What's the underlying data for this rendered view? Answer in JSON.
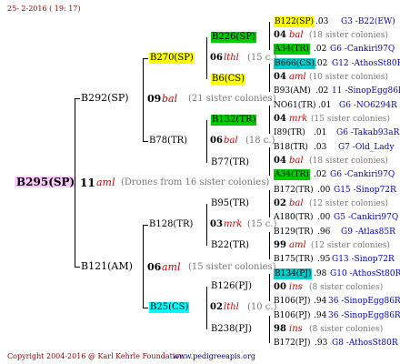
{
  "header": {
    "date": "25- 2-2016 ( 19: 17)"
  },
  "root": {
    "id": "B295(SP)",
    "num": "11",
    "race": "aml",
    "note": "(Drones from 16 sister colonies)"
  },
  "gen1": {
    "upper": {
      "id": "B292(SP)",
      "num": "09",
      "race": "bal",
      "note": "(21 sister colonies)"
    },
    "lower": {
      "id": "B121(AM)",
      "num": "06",
      "race": "aml",
      "note": "(15 sister colonies)"
    }
  },
  "gen2": [
    {
      "id": "B270(SP)",
      "num": "06",
      "race": "lthl",
      "note": "(15 c.)",
      "bg": "#ffff00"
    },
    {
      "id": "B78(TR)",
      "num": "06",
      "race": "bal",
      "note": "(18 c.)",
      "bg": ""
    },
    {
      "id": "B128(TR)",
      "num": "03",
      "race": "mrk",
      "note": "(15 c.)",
      "bg": ""
    },
    {
      "id": "B25(CS)",
      "num": "02",
      "race": "lthl",
      "note": "(10 c.)",
      "bg": "#00ffff"
    }
  ],
  "gen3": [
    {
      "id": "B226(SP)",
      "bg": "#00cc00"
    },
    {
      "id": "B6(CS)",
      "bg": "#ffff00"
    },
    {
      "id": "B132(TR)",
      "bg": "#00cc00"
    },
    {
      "id": "B77(TR)",
      "bg": ""
    },
    {
      "id": "B95(TR)",
      "bg": ""
    },
    {
      "id": "B22(TR)",
      "bg": ""
    },
    {
      "id": "B126(PJ)",
      "bg": ""
    },
    {
      "id": "B238(PJ)",
      "bg": ""
    }
  ],
  "gen4": [
    {
      "a": "B122(SP)",
      "av": ".03",
      "b": "G3 -B22(EW)",
      "abg": "#ffff00",
      "num": "04",
      "race": "bal",
      "note": "(18 sister colonies)",
      "c": "A34(TR)",
      "cv": ".02",
      "d": "G6 -Cankiri97Q",
      "cbg": "#00cc00"
    },
    {
      "a": "B666(CS)",
      "av": ".02",
      "b": "G12 -AthosSt80R",
      "abg": "#00cccc",
      "num": "04",
      "race": "aml",
      "note": "(10 sister colonies)",
      "c": "B93(AM)",
      "cv": ".02",
      "d": "11 -SinopEgg86R",
      "cbg": ""
    },
    {
      "a": "NO61(TR)",
      "av": ".01",
      "b": "G6 -NO6294R",
      "abg": "",
      "num": "04",
      "race": "mrk",
      "note": "(15 sister colonies)",
      "c": "I89(TR)",
      "cv": ".01",
      "d": "G6 -Takab93aR",
      "cbg": ""
    },
    {
      "a": "B18(TR)",
      "av": ".03",
      "b": "G7 -Old_Lady",
      "abg": "",
      "num": "04",
      "race": "bal",
      "note": "(18 sister colonies)",
      "c": "A34(TR)",
      "cv": ".02",
      "d": "G6 -Cankiri97Q",
      "cbg": "#00cc00"
    },
    {
      "a": "B172(TR)",
      "av": ".00",
      "b": "G15 -Sinop72R",
      "abg": "",
      "num": "02",
      "race": "bal",
      "note": "(12 sister colonies)",
      "c": "A180(TR)",
      "cv": ".00",
      "d": "G5 -Cankiri97Q",
      "cbg": ""
    },
    {
      "a": "B129(TR)",
      "av": ".96",
      "b": "G9 -Atlas85R",
      "abg": "",
      "num": "99",
      "race": "aml",
      "note": "(12 sister colonies)",
      "c": "B175(TR)",
      "cv": ".95",
      "d": "G13 -Sinop72R",
      "cbg": ""
    },
    {
      "a": "B134(PJ)",
      "av": ".98",
      "b": "G10 -AthosSt80R",
      "abg": "#00cccc",
      "num": "00",
      "race": "ins",
      "note": "(8 sister colonies)",
      "c": "B106(PJ)",
      "cv": ".94",
      "d": "36 -SinopEgg86R",
      "cbg": ""
    },
    {
      "a": "B106(PJ)",
      "av": ".94",
      "b": "36 -SinopEgg86R",
      "abg": "",
      "num": "98",
      "race": "ins",
      "note": "(8 sister colonies)",
      "c": "B172(PJ)",
      "cv": ".93",
      "d": "G8 -AthosSt80R",
      "cbg": ""
    }
  ],
  "footer": {
    "copyright": "Copyright 2004-2016 @ Karl Kehrle Foundation.",
    "site": "www.pedigreeapis.org"
  }
}
